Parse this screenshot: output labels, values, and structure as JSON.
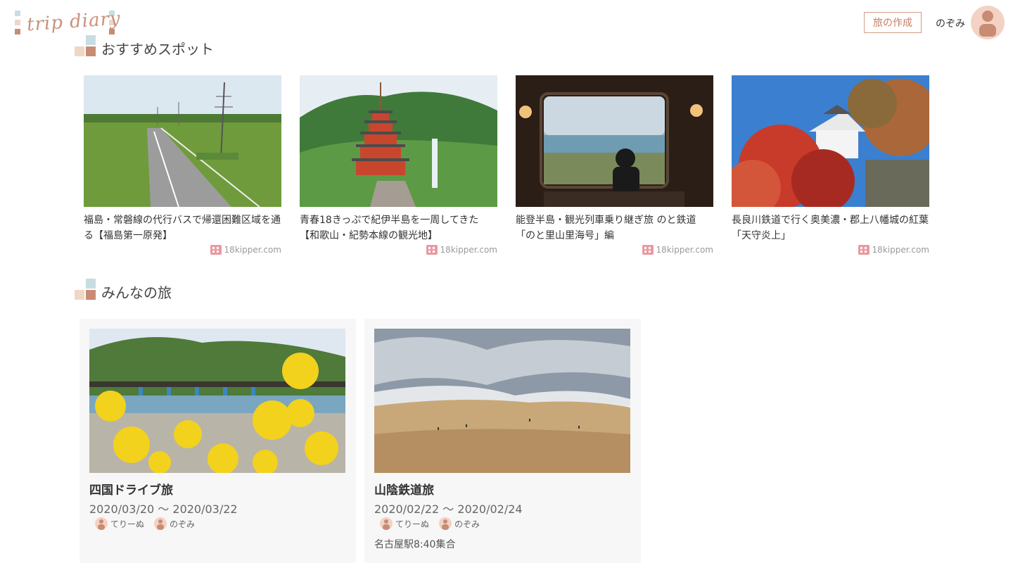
{
  "header": {
    "logo_text": "trip diary",
    "create_button": "旅の作成",
    "user_name": "のぞみ"
  },
  "colors": {
    "accent": "#c77d62",
    "deco_blue": "#c7dde3",
    "deco_beige": "#efd7c6",
    "deco_brown": "#c98b74"
  },
  "recommended": {
    "title": "おすすめスポット",
    "spots": [
      {
        "title": "福島・常磐線の代行バスで帰還困難区域を通る【福島第一原発】",
        "source": "18kipper.com"
      },
      {
        "title": "青春18きっぷで紀伊半島を一周してきた【和歌山・紀勢本線の観光地】",
        "source": "18kipper.com"
      },
      {
        "title": "能登半島・観光列車乗り継ぎ旅 のと鉄道「のと里山里海号」編",
        "source": "18kipper.com"
      },
      {
        "title": "長良川鉄道で行く奥美濃・郡上八幡城の紅葉「天守炎上」",
        "source": "18kipper.com"
      }
    ]
  },
  "everyone": {
    "title": "みんなの旅",
    "trips": [
      {
        "name": "四国ドライブ旅",
        "dates": "2020/03/20 〜 2020/03/22",
        "members": [
          "てりーぬ",
          "のぞみ"
        ],
        "note": ""
      },
      {
        "name": "山陰鉄道旅",
        "dates": "2020/02/22 〜 2020/02/24",
        "members": [
          "てりーぬ",
          "のぞみ"
        ],
        "note": "名古屋駅8:40集合"
      }
    ]
  }
}
